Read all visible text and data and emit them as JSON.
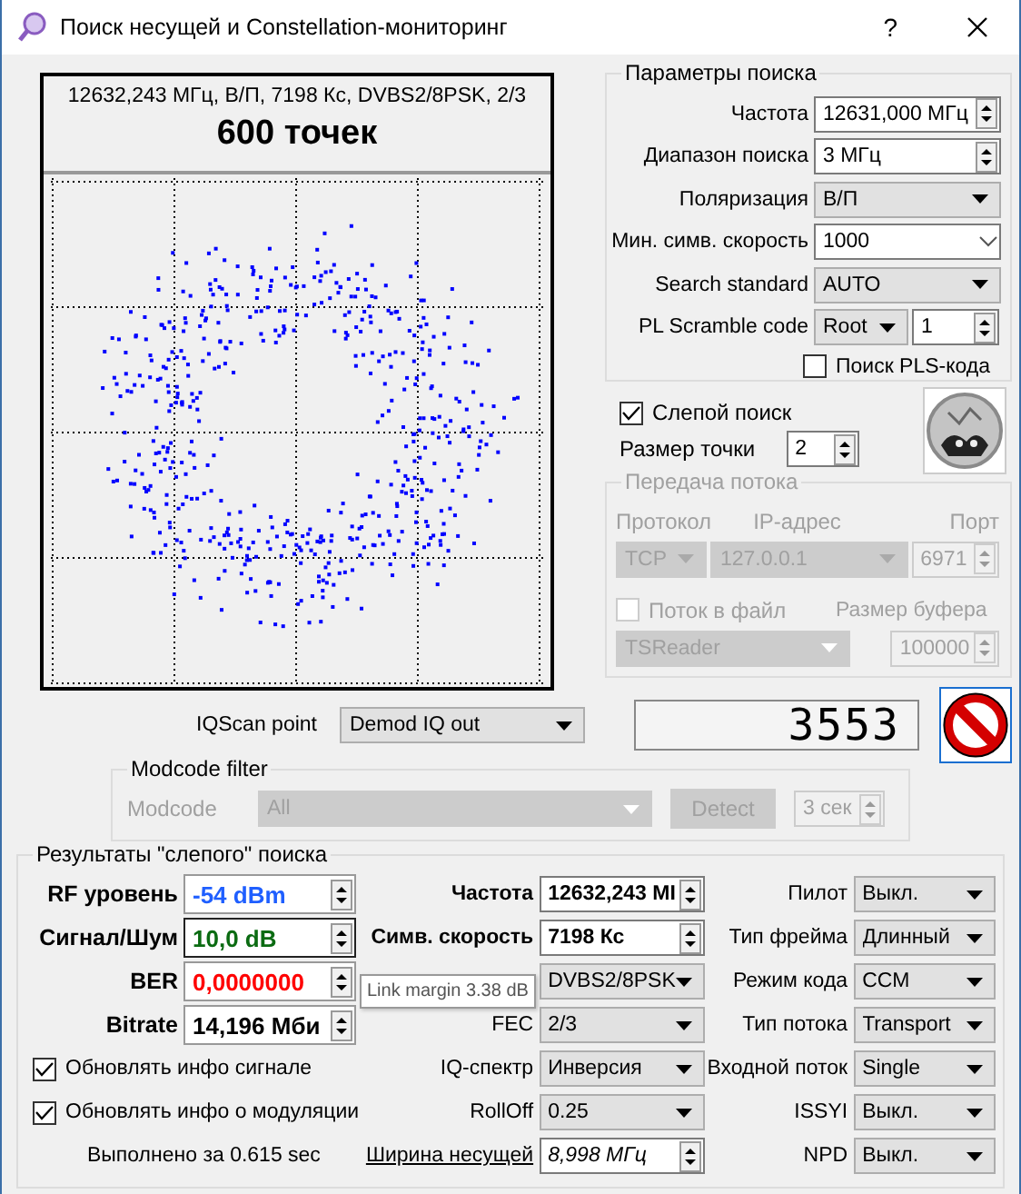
{
  "window": {
    "title": "Поиск несущей и Constellation-мониторинг",
    "help": "?"
  },
  "constellation": {
    "info": "12632,243 МГц, В/П, 7198 Кс, DVBS2/8PSK, 2/3",
    "points": "600 точек"
  },
  "iqscan": {
    "label": "IQScan point",
    "value": "Demod IQ out"
  },
  "modcode_filter": {
    "title": "Modcode filter",
    "disabled": true,
    "label": "Modcode",
    "value": "All",
    "detect": "Detect",
    "timeout": "3 сек"
  },
  "search_params": {
    "title": "Параметры поиска",
    "rows": [
      {
        "kind": "spin",
        "label": "Частота",
        "value": "12631,000 МГц"
      },
      {
        "kind": "spin",
        "label": "Диапазон поиска",
        "value": "3 МГц"
      },
      {
        "kind": "combo",
        "label": "Поляризация",
        "value": "В/П"
      },
      {
        "kind": "edit",
        "label": "Мин. симв. скорость",
        "value": "1000"
      },
      {
        "kind": "combo",
        "label": "Search standard",
        "value": "AUTO"
      },
      {
        "kind": "combo-spin",
        "label": "PL Scramble code",
        "value": "Root",
        "value2": "1"
      }
    ],
    "pls_search": {
      "label": "Поиск PLS-кода",
      "checked": false
    }
  },
  "blind_search": {
    "label": "Слепой поиск",
    "checked": true
  },
  "point_size": {
    "label": "Размер точки",
    "value": "2"
  },
  "stream": {
    "title": "Передача потока",
    "disabled": true,
    "protocol_label": "Протокол",
    "ip_label": "IP-адрес",
    "port_label": "Порт",
    "protocol": "TCP",
    "ip": "127.0.0.1",
    "port": "6971",
    "to_file": {
      "label": "Поток в файл",
      "checked": false
    },
    "buffer_label": "Размер буфера",
    "reader": "TSReader",
    "buffer": "100000"
  },
  "counter": "3553",
  "results": {
    "title": "Результаты \"слепого\" поиска",
    "col1": [
      {
        "label": "RF уровень",
        "value": "-54 dBm",
        "color": "#1f5fff"
      },
      {
        "label": "Сигнал/Шум",
        "value": "10,0 dB",
        "color": "#0b6b12"
      },
      {
        "label": "BER",
        "value": "0,0000000",
        "color": "#ff0000"
      },
      {
        "label": "Bitrate",
        "value": "14,196 Мби",
        "color": "#000000"
      }
    ],
    "checks": [
      {
        "label": "Обновлять инфо сигнале",
        "checked": true
      },
      {
        "label": "Обновлять инфо о модуляции",
        "checked": true
      }
    ],
    "elapsed": "Выполнено за 0.615 sec",
    "col2": [
      {
        "kind": "spin-bold",
        "label": "Частота",
        "value": "12632,243 МI"
      },
      {
        "kind": "spin-bold",
        "label": "Симв. скорость",
        "value": "7198 Кс"
      },
      {
        "kind": "combo",
        "value": "DVBS2/8PSK"
      },
      {
        "kind": "combo",
        "label": "FEC",
        "value": "2/3"
      },
      {
        "kind": "combo",
        "label": "IQ-спектр",
        "value": "Инверсия"
      },
      {
        "kind": "combo",
        "label": "RollOff",
        "value": "0.25"
      },
      {
        "kind": "link-spin",
        "label": "Ширина несущей",
        "value": "8,998 МГц"
      }
    ],
    "col3": [
      {
        "label": "Пилот",
        "value": "Выкл."
      },
      {
        "label": "Тип фрейма",
        "value": "Длинный"
      },
      {
        "label": "Режим кода",
        "value": "CCM"
      },
      {
        "label": "Тип потока",
        "value": "Transport"
      },
      {
        "label": "Входной поток",
        "value": "Single"
      },
      {
        "label": "ISSYI",
        "value": "Выкл."
      },
      {
        "label": "NPD",
        "value": "Выкл."
      }
    ],
    "tooltip": "Link margin 3.38 dB"
  }
}
